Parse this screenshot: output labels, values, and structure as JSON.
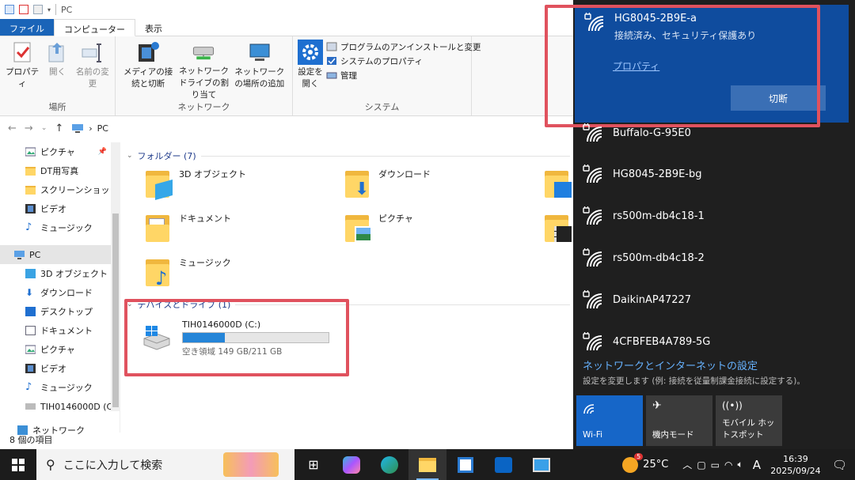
{
  "window": {
    "title": "PC",
    "tabs": {
      "file": "ファイル",
      "computer": "コンピューター",
      "view": "表示"
    }
  },
  "ribbon": {
    "location": {
      "label": "場所",
      "properties": "プロパティ",
      "open": "開く",
      "rename": "名前の変更"
    },
    "network": {
      "label": "ネットワーク",
      "media": "メディアの接続と切断",
      "map_drive": "ネットワーク ドライブの割り当て",
      "add_location": "ネットワークの場所の追加"
    },
    "system": {
      "label": "システム",
      "open_settings": "設定を開く",
      "uninstall": "プログラムのアンインストールと変更",
      "sys_props": "システムのプロパティ",
      "manage": "管理"
    }
  },
  "address": {
    "path": "PC"
  },
  "nav": {
    "quick": [
      {
        "label": "ピクチャ"
      },
      {
        "label": "DT用写真"
      },
      {
        "label": "スクリーンショット"
      },
      {
        "label": "ビデオ"
      },
      {
        "label": "ミュージック"
      }
    ],
    "pc": "PC",
    "pc_items": [
      {
        "label": "3D オブジェクト"
      },
      {
        "label": "ダウンロード"
      },
      {
        "label": "デスクトップ"
      },
      {
        "label": "ドキュメント"
      },
      {
        "label": "ピクチャ"
      },
      {
        "label": "ビデオ"
      },
      {
        "label": "ミュージック"
      },
      {
        "label": "TIH0146000D (C"
      }
    ],
    "network": "ネットワーク"
  },
  "folders_header": "フォルダー (7)",
  "folders": [
    {
      "name": "3D オブジェクト"
    },
    {
      "name": "ダウンロード"
    },
    {
      "name": ""
    },
    {
      "name": "ドキュメント"
    },
    {
      "name": "ピクチャ"
    },
    {
      "name": ""
    },
    {
      "name": "ミュージック"
    }
  ],
  "drives_header": "デバイスとドライブ (1)",
  "drive": {
    "name": "TIH0146000D (C:)",
    "free": "空き領域 149 GB/211 GB",
    "used_fraction": 0.29
  },
  "status": "8 個の項目",
  "wifi": {
    "connected": {
      "name": "HG8045-2B9E-a",
      "status": "接続済み、セキュリティ保護あり",
      "properties": "プロパティ",
      "disconnect": "切断"
    },
    "networks": [
      {
        "name": "Buffalo-G-95E0"
      },
      {
        "name": "HG8045-2B9E-bg"
      },
      {
        "name": "rs500m-db4c18-1"
      },
      {
        "name": "rs500m-db4c18-2"
      },
      {
        "name": "DaikinAP47227"
      },
      {
        "name": "4CFBFEB4A789-5G"
      }
    ],
    "settings_link": "ネットワークとインターネットの設定",
    "settings_sub": "設定を変更します (例: 接続を従量制課金接続に設定する)。",
    "tiles": {
      "wifi": "Wi-Fi",
      "airplane": "機内モード",
      "hotspot": "モバイル ホットスポット"
    }
  },
  "taskbar": {
    "search_placeholder": "ここに入力して検索",
    "weather": "25°C",
    "weather_badge": "5",
    "ime": "A",
    "time": "16:39",
    "date": "2025/09/24"
  },
  "colors": {
    "accent": "#1666c8",
    "highlight": "#e0525e",
    "flyout_bg": "#1f1f1f"
  }
}
